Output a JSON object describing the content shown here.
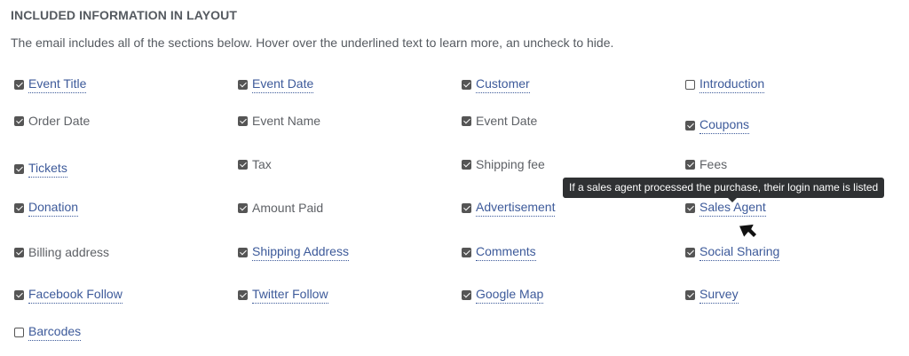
{
  "section": {
    "title": "INCLUDED INFORMATION IN LAYOUT",
    "description": "The email includes all of the sections below. Hover over the underlined text to learn more, an uncheck to hide."
  },
  "options": [
    {
      "label": "Event Title",
      "checked": true,
      "has_tooltip": true
    },
    {
      "label": "Event Date",
      "checked": true,
      "has_tooltip": true
    },
    {
      "label": "Customer",
      "checked": true,
      "has_tooltip": true
    },
    {
      "label": "Introduction",
      "checked": false,
      "has_tooltip": true
    },
    {
      "label": "Order Date",
      "checked": true,
      "has_tooltip": false
    },
    {
      "label": "Event Name",
      "checked": true,
      "has_tooltip": false
    },
    {
      "label": "Event Date",
      "checked": true,
      "has_tooltip": false
    },
    {
      "label": "Coupons",
      "checked": true,
      "has_tooltip": true
    },
    {
      "label": "Tickets",
      "checked": true,
      "has_tooltip": true
    },
    {
      "label": "Tax",
      "checked": true,
      "has_tooltip": false
    },
    {
      "label": "Shipping fee",
      "checked": true,
      "has_tooltip": false
    },
    {
      "label": "Fees",
      "checked": true,
      "has_tooltip": false
    },
    {
      "label": "Donation",
      "checked": true,
      "has_tooltip": true
    },
    {
      "label": "Amount Paid",
      "checked": true,
      "has_tooltip": false
    },
    {
      "label": "Advertisement",
      "checked": true,
      "has_tooltip": true
    },
    {
      "label": "Sales Agent",
      "checked": true,
      "has_tooltip": true
    },
    {
      "label": "Billing address",
      "checked": true,
      "has_tooltip": false
    },
    {
      "label": "Shipping Address",
      "checked": true,
      "has_tooltip": true
    },
    {
      "label": "Comments",
      "checked": true,
      "has_tooltip": true
    },
    {
      "label": "Social Sharing",
      "checked": true,
      "has_tooltip": true
    },
    {
      "label": "Facebook Follow",
      "checked": true,
      "has_tooltip": true
    },
    {
      "label": "Twitter Follow",
      "checked": true,
      "has_tooltip": true
    },
    {
      "label": "Google Map",
      "checked": true,
      "has_tooltip": true
    },
    {
      "label": "Survey",
      "checked": true,
      "has_tooltip": true
    },
    {
      "label": "Barcodes",
      "checked": false,
      "has_tooltip": true
    }
  ],
  "tooltip": {
    "text": "If a sales agent processed the purchase, their login name is listed"
  },
  "colors": {
    "link": "#3d5a9a",
    "text": "#5e6166",
    "tooltip_bg": "#2f3133",
    "checkbox": "#555555"
  },
  "icons": {
    "cursor": "arrow-cursor-icon",
    "checkbox_checked": "checkbox-checked-icon",
    "checkbox_unchecked": "checkbox-empty-icon"
  }
}
